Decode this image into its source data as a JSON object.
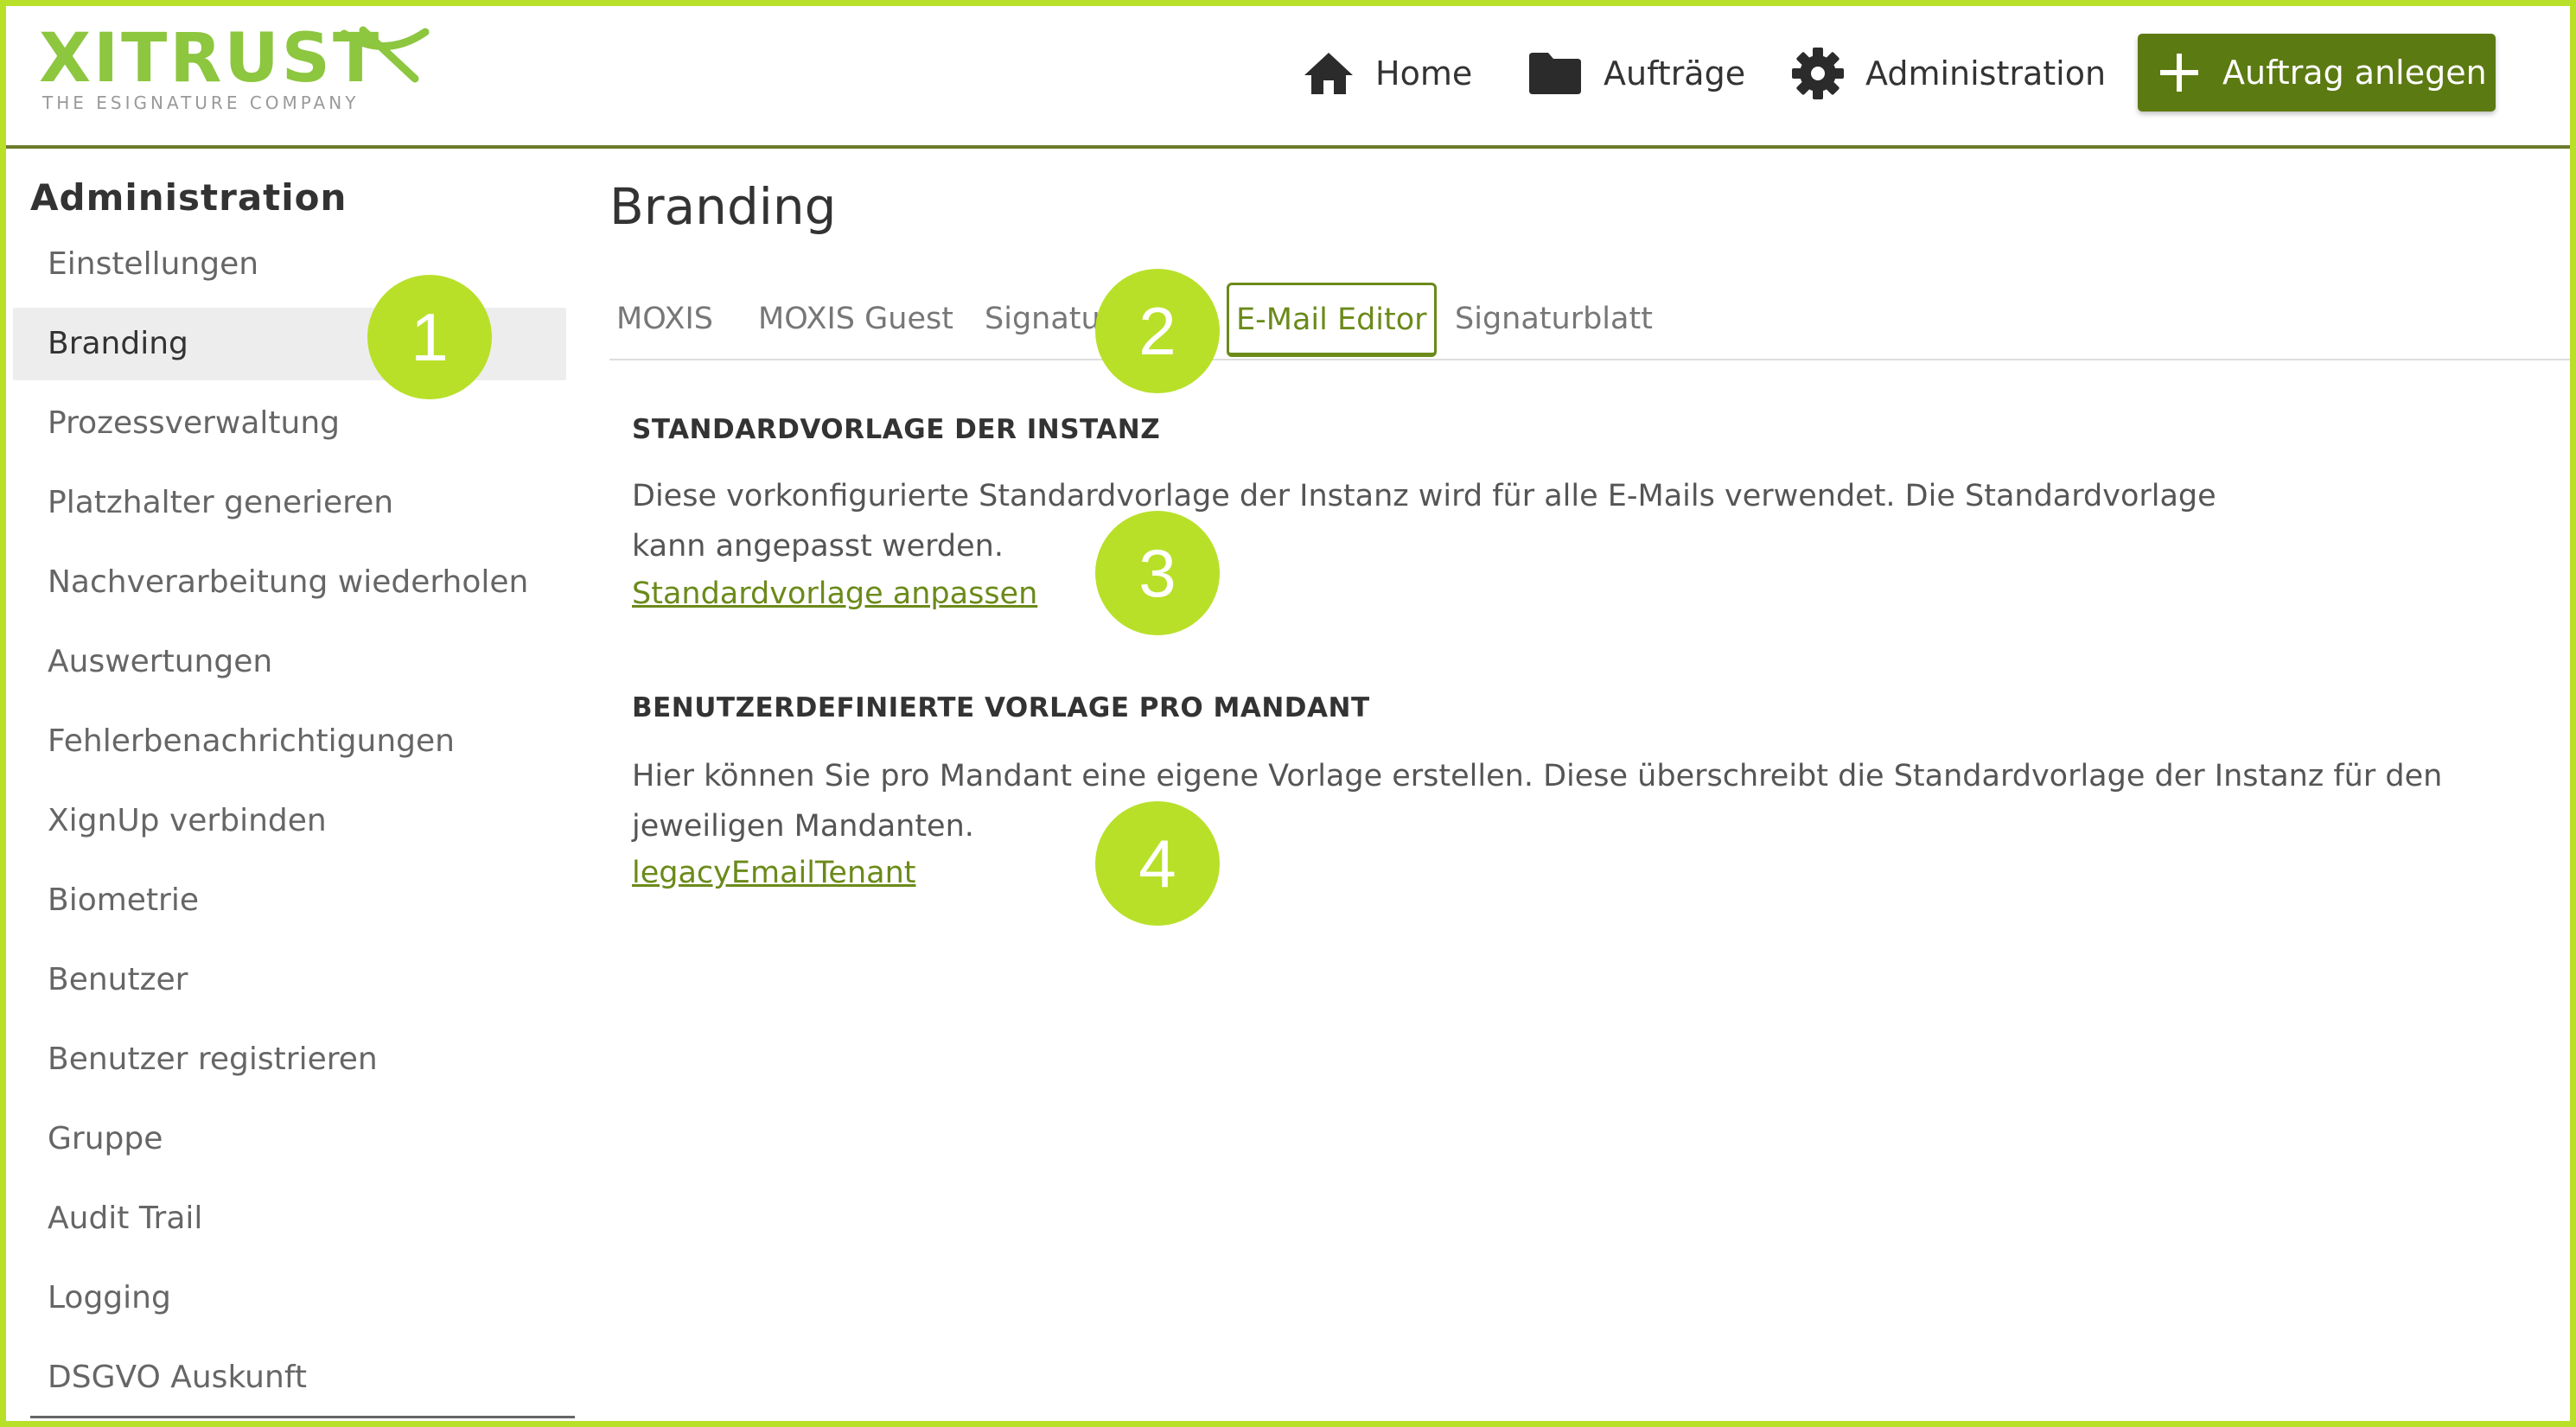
{
  "header": {
    "logo_text": "XITRUST",
    "logo_tagline": "THE ESIGNATURE COMPANY",
    "nav": [
      {
        "label": "Home",
        "icon": "home-icon"
      },
      {
        "label": "Aufträge",
        "icon": "folder-icon"
      },
      {
        "label": "Administration",
        "icon": "gear-icon"
      }
    ],
    "create_button_label": "Auftrag anlegen",
    "create_button_icon": "plus-icon"
  },
  "sidebar": {
    "title": "Administration",
    "items": [
      {
        "label": "Einstellungen",
        "active": false
      },
      {
        "label": "Branding",
        "active": true
      },
      {
        "label": "Prozessverwaltung",
        "active": false
      },
      {
        "label": "Platzhalter generieren",
        "active": false
      },
      {
        "label": "Nachverarbeitung wiederholen",
        "active": false
      },
      {
        "label": "Auswertungen",
        "active": false
      },
      {
        "label": "Fehlerbenachrichtigungen",
        "active": false
      },
      {
        "label": "XignUp verbinden",
        "active": false
      },
      {
        "label": "Biometrie",
        "active": false
      },
      {
        "label": "Benutzer",
        "active": false
      },
      {
        "label": "Benutzer registrieren",
        "active": false
      },
      {
        "label": "Gruppe",
        "active": false
      },
      {
        "label": "Audit Trail",
        "active": false
      },
      {
        "label": "Logging",
        "active": false
      },
      {
        "label": "DSGVO Auskunft",
        "active": false
      }
    ]
  },
  "main": {
    "title": "Branding",
    "tabs": [
      {
        "label": "MOXIS",
        "active": false
      },
      {
        "label": "MOXIS Guest",
        "active": false
      },
      {
        "label": "Signatur",
        "active": false
      },
      {
        "label": "E-Mail Editor",
        "active": true
      },
      {
        "label": "Signaturblatt",
        "active": false
      }
    ],
    "sections": [
      {
        "heading": "STANDARDVORLAGE DER INSTANZ",
        "text": "Diese vorkonfigurierte Standardvorlage der Instanz wird für alle E-Mails verwendet. Die Standardvorlage kann angepasst werden.",
        "link": "Standardvorlage anpassen"
      },
      {
        "heading": "BENUTZERDEFINIERTE VORLAGE PRO MANDANT",
        "text": "Hier können Sie pro Mandant eine eigene Vorlage erstellen. Diese überschreibt die Standardvorlage der Instanz für den jeweiligen Mandanten.",
        "link": "legacyEmailTenant"
      }
    ]
  },
  "markers": [
    "1",
    "2",
    "3",
    "4"
  ],
  "colors": {
    "brand_green": "#8dc63f",
    "button_green": "#5c7a12",
    "marker_green": "#b8e029",
    "link_green": "#6b8a1a",
    "frame_border": "#b8e029"
  }
}
